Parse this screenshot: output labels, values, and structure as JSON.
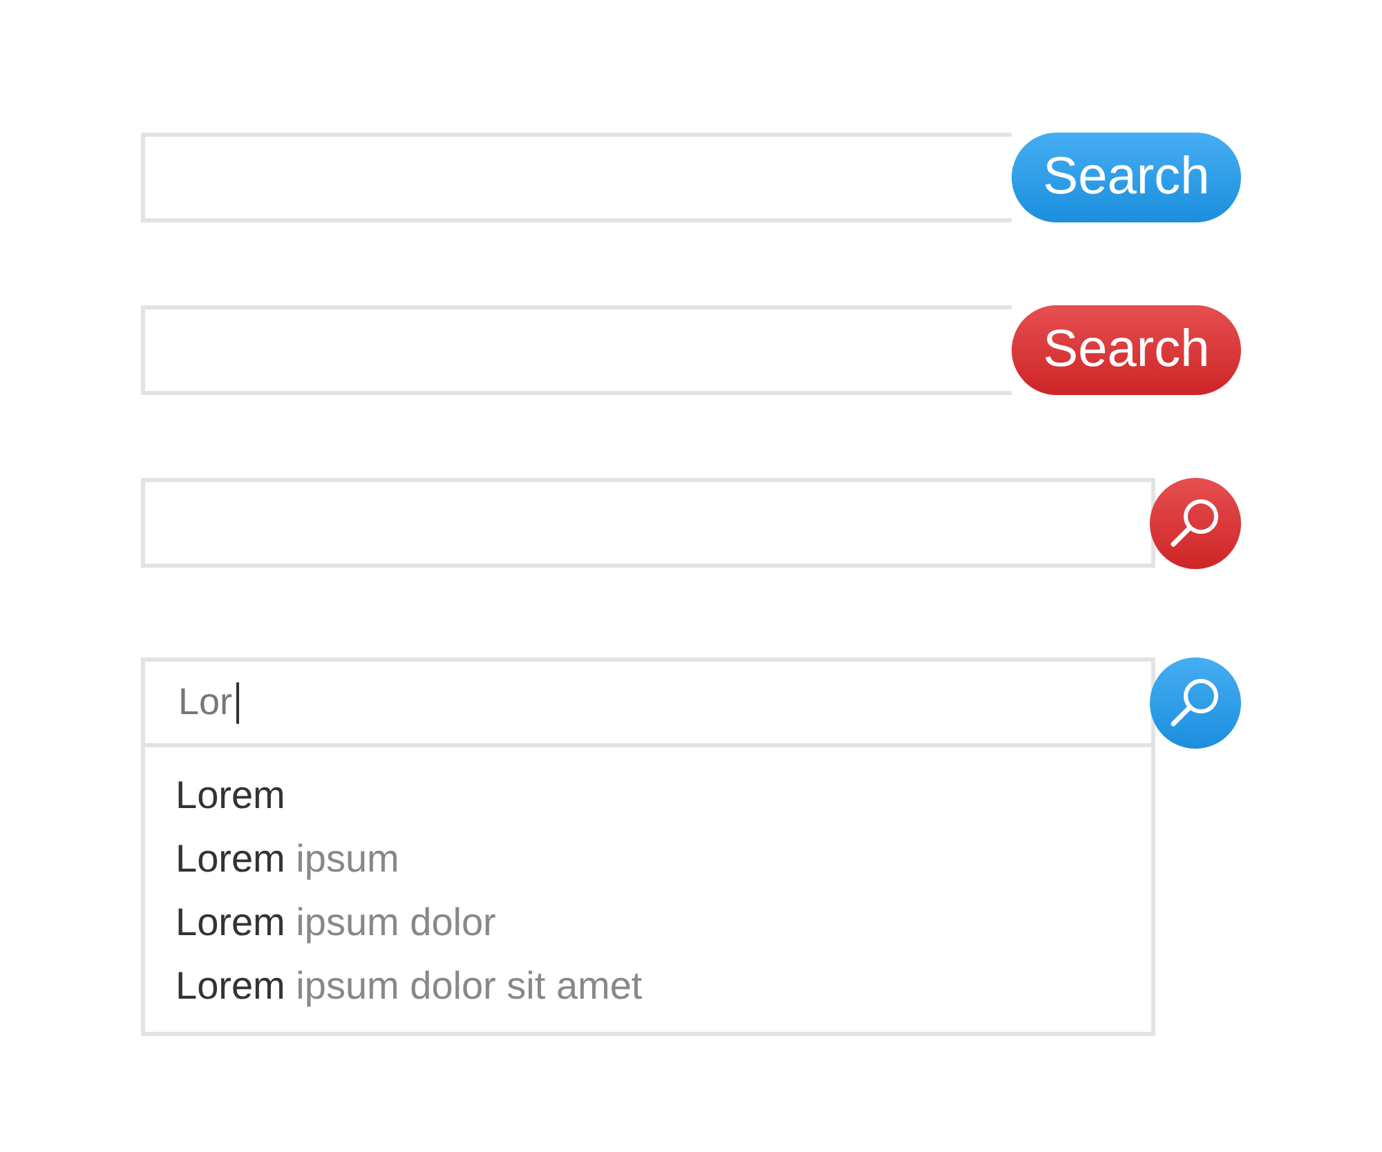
{
  "search_bars": [
    {
      "kind": "text-button",
      "button_label": "Search",
      "color": "#1d9bf0",
      "focused": false
    },
    {
      "kind": "text-button",
      "button_label": "Search",
      "color": "#e0282a",
      "focused": false
    },
    {
      "kind": "icon-button",
      "color": "#e0282a",
      "focused": false
    },
    {
      "kind": "icon-button",
      "color": "#1d9bf0",
      "value": "Lor",
      "focused": true,
      "suggestions": [
        {
          "match": "Lorem"
        },
        {
          "match": "Lorem",
          "rest": "ipsum"
        },
        {
          "match": "Lorem",
          "rest": "ipsum dolor"
        },
        {
          "match": "Lorem",
          "rest": "ipsum dolor sit amet"
        }
      ]
    }
  ]
}
